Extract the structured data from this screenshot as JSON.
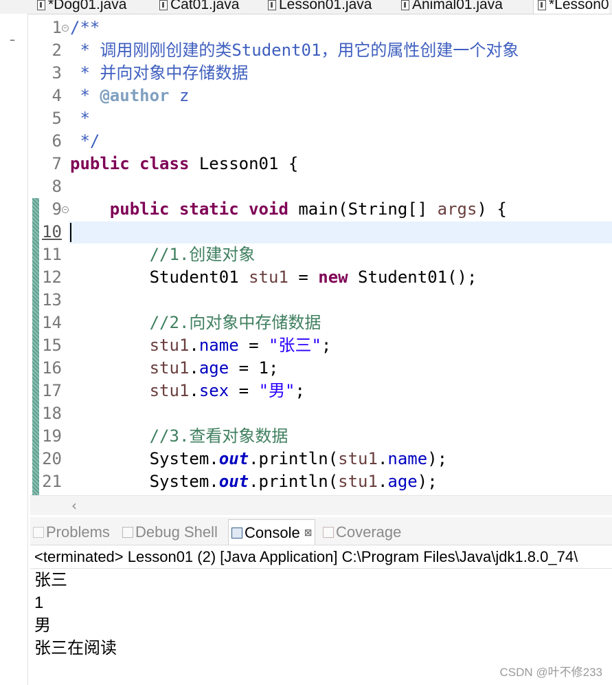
{
  "editor_tabs": [
    {
      "label": "*Dog01.java",
      "active": false
    },
    {
      "label": "Cat01.java",
      "active": false
    },
    {
      "label": "Lesson01.java",
      "active": false
    },
    {
      "label": "Animal01.java",
      "active": false
    },
    {
      "label": "*Lesson0",
      "active": true
    }
  ],
  "editor": {
    "current_line": 10,
    "lines": [
      {
        "n": "1",
        "fold": true,
        "tokens": [
          {
            "t": "/**",
            "c": "doc"
          }
        ]
      },
      {
        "n": "2",
        "tokens": [
          {
            "t": " * 调用刚刚创建的类Student01，用它的属性创建一个对象",
            "c": "doc"
          }
        ]
      },
      {
        "n": "3",
        "tokens": [
          {
            "t": " * 并向对象中存储数据",
            "c": "doc"
          }
        ]
      },
      {
        "n": "4",
        "tokens": [
          {
            "t": " * ",
            "c": "doc"
          },
          {
            "t": "@author",
            "c": "tag"
          },
          {
            "t": " z",
            "c": "doc"
          }
        ]
      },
      {
        "n": "5",
        "tokens": [
          {
            "t": " *",
            "c": "doc"
          }
        ]
      },
      {
        "n": "6",
        "tokens": [
          {
            "t": " */",
            "c": "doc"
          }
        ]
      },
      {
        "n": "7",
        "tokens": [
          {
            "t": "public",
            "c": "kw"
          },
          {
            "t": " ",
            "c": "plain"
          },
          {
            "t": "class",
            "c": "kw"
          },
          {
            "t": " Lesson01 {",
            "c": "plain"
          }
        ]
      },
      {
        "n": "8",
        "tokens": []
      },
      {
        "n": "9",
        "fold": true,
        "tokens": [
          {
            "t": "    ",
            "c": "plain"
          },
          {
            "t": "public",
            "c": "kw"
          },
          {
            "t": " ",
            "c": "plain"
          },
          {
            "t": "static",
            "c": "kw"
          },
          {
            "t": " ",
            "c": "plain"
          },
          {
            "t": "void",
            "c": "kw"
          },
          {
            "t": " main(String[] ",
            "c": "plain"
          },
          {
            "t": "args",
            "c": "local"
          },
          {
            "t": ") {",
            "c": "plain"
          }
        ]
      },
      {
        "n": "10",
        "tokens": []
      },
      {
        "n": "11",
        "tokens": [
          {
            "t": "        ",
            "c": "plain"
          },
          {
            "t": "//1.创建对象",
            "c": "cm"
          }
        ]
      },
      {
        "n": "12",
        "tokens": [
          {
            "t": "        Student01 ",
            "c": "plain"
          },
          {
            "t": "stu1",
            "c": "local"
          },
          {
            "t": " = ",
            "c": "plain"
          },
          {
            "t": "new",
            "c": "kw"
          },
          {
            "t": " Student01();",
            "c": "plain"
          }
        ]
      },
      {
        "n": "13",
        "tokens": []
      },
      {
        "n": "14",
        "tokens": [
          {
            "t": "        ",
            "c": "plain"
          },
          {
            "t": "//2.向对象中存储数据",
            "c": "cm"
          }
        ]
      },
      {
        "n": "15",
        "tokens": [
          {
            "t": "        ",
            "c": "plain"
          },
          {
            "t": "stu1",
            "c": "local"
          },
          {
            "t": ".",
            "c": "plain"
          },
          {
            "t": "name",
            "c": "field"
          },
          {
            "t": " = ",
            "c": "plain"
          },
          {
            "t": "\"张三\"",
            "c": "str"
          },
          {
            "t": ";",
            "c": "plain"
          }
        ]
      },
      {
        "n": "16",
        "tokens": [
          {
            "t": "        ",
            "c": "plain"
          },
          {
            "t": "stu1",
            "c": "local"
          },
          {
            "t": ".",
            "c": "plain"
          },
          {
            "t": "age",
            "c": "field"
          },
          {
            "t": " = 1;",
            "c": "plain"
          }
        ]
      },
      {
        "n": "17",
        "tokens": [
          {
            "t": "        ",
            "c": "plain"
          },
          {
            "t": "stu1",
            "c": "local"
          },
          {
            "t": ".",
            "c": "plain"
          },
          {
            "t": "sex",
            "c": "field"
          },
          {
            "t": " = ",
            "c": "plain"
          },
          {
            "t": "\"男\"",
            "c": "str"
          },
          {
            "t": ";",
            "c": "plain"
          }
        ]
      },
      {
        "n": "18",
        "tokens": []
      },
      {
        "n": "19",
        "tokens": [
          {
            "t": "        ",
            "c": "plain"
          },
          {
            "t": "//3.查看对象数据",
            "c": "cm"
          }
        ]
      },
      {
        "n": "20",
        "tokens": [
          {
            "t": "        System.",
            "c": "plain"
          },
          {
            "t": "out",
            "c": "static"
          },
          {
            "t": ".println(",
            "c": "plain"
          },
          {
            "t": "stu1",
            "c": "local"
          },
          {
            "t": ".",
            "c": "plain"
          },
          {
            "t": "name",
            "c": "field"
          },
          {
            "t": ");",
            "c": "plain"
          }
        ]
      },
      {
        "n": "21",
        "tokens": [
          {
            "t": "        System.",
            "c": "plain"
          },
          {
            "t": "out",
            "c": "static"
          },
          {
            "t": ".println(",
            "c": "plain"
          },
          {
            "t": "stu1",
            "c": "local"
          },
          {
            "t": ".",
            "c": "plain"
          },
          {
            "t": "age",
            "c": "field"
          },
          {
            "t": ");",
            "c": "plain"
          }
        ]
      }
    ]
  },
  "panel": {
    "tabs": [
      {
        "label": "Problems",
        "icon": "problems-icon",
        "active": false
      },
      {
        "label": "Debug Shell",
        "icon": "debug-shell-icon",
        "active": false
      },
      {
        "label": "Console",
        "icon": "console-icon",
        "active": true,
        "close": "⊠"
      },
      {
        "label": "Coverage",
        "icon": "coverage-icon",
        "active": false
      }
    ]
  },
  "console": {
    "header": "<terminated> Lesson01 (2) [Java Application] C:\\Program Files\\Java\\jdk1.8.0_74\\",
    "output": [
      "张三",
      "1",
      "男",
      "张三在阅读"
    ]
  },
  "watermark": "CSDN @叶不修233",
  "colors": {
    "keyword": "#7f0055",
    "javadoc": "#3f5fbf",
    "comment": "#3f7f5f",
    "string": "#2a00ff",
    "field": "#0000c0",
    "local_var": "#6a3e3e",
    "current_line_bg": "#e8f2fe"
  }
}
